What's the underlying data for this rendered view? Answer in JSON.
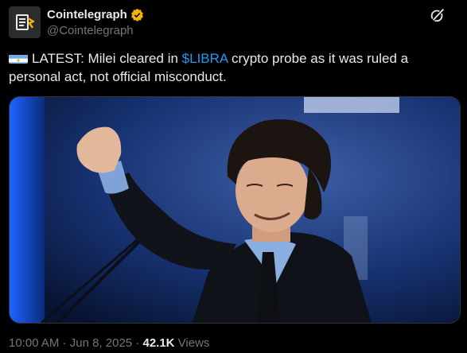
{
  "author": {
    "display_name": "Cointelegraph",
    "handle": "@Cointelegraph",
    "verified_badge_color": "#f5b400",
    "avatar_icon": "cointelegraph-logo"
  },
  "post": {
    "flag_icon": "argentina-flag",
    "text_before_tag": "LATEST: Milei cleared in ",
    "cashtag": "$LIBRA",
    "text_after_tag": " crypto probe as it was ruled a personal act, not official misconduct."
  },
  "media": {
    "icon": "photo-man-raising-fist",
    "background_color": "#0a1738"
  },
  "meta": {
    "time": "10:00 AM",
    "sep1": " · ",
    "date": "Jun 8, 2025",
    "sep2": " · ",
    "views_count": "42.1K",
    "views_label": " Views"
  },
  "colors": {
    "link": "#1d9bf0",
    "text": "#e7e9ea",
    "muted": "#71767b",
    "background": "#000000"
  }
}
